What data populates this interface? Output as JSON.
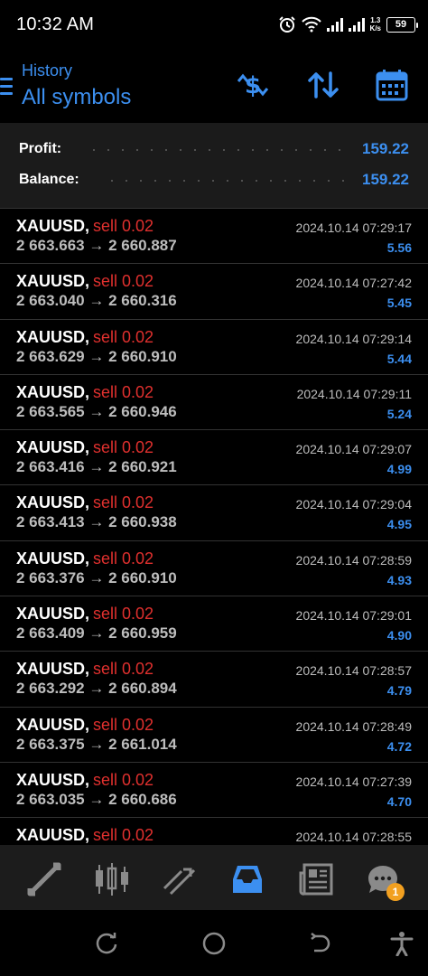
{
  "status_bar": {
    "time": "10:32 AM",
    "net_speed_value": "1.3",
    "net_speed_unit": "K/s",
    "battery": "59",
    "icons": [
      "alarm-icon",
      "wifi-icon",
      "signal-icon",
      "signal-icon-2"
    ]
  },
  "header": {
    "subtitle": "History",
    "title": "All symbols",
    "icons": [
      "menu-icon",
      "currency-sort-icon",
      "sort-icon",
      "calendar-icon"
    ]
  },
  "summary": {
    "profit_label": "Profit:",
    "profit_value": "159.22",
    "balance_label": "Balance:",
    "balance_value": "159.22"
  },
  "deals": [
    {
      "symbol": "XAUUSD,",
      "type": "sell 0.02",
      "prices": "2 663.663 → 2 660.887",
      "time": "2024.10.14 07:29:17",
      "profit": "5.56"
    },
    {
      "symbol": "XAUUSD,",
      "type": "sell 0.02",
      "prices": "2 663.040 → 2 660.316",
      "time": "2024.10.14 07:27:42",
      "profit": "5.45"
    },
    {
      "symbol": "XAUUSD,",
      "type": "sell 0.02",
      "prices": "2 663.629 → 2 660.910",
      "time": "2024.10.14 07:29:14",
      "profit": "5.44"
    },
    {
      "symbol": "XAUUSD,",
      "type": "sell 0.02",
      "prices": "2 663.565 → 2 660.946",
      "time": "2024.10.14 07:29:11",
      "profit": "5.24"
    },
    {
      "symbol": "XAUUSD,",
      "type": "sell 0.02",
      "prices": "2 663.416 → 2 660.921",
      "time": "2024.10.14 07:29:07",
      "profit": "4.99"
    },
    {
      "symbol": "XAUUSD,",
      "type": "sell 0.02",
      "prices": "2 663.413 → 2 660.938",
      "time": "2024.10.14 07:29:04",
      "profit": "4.95"
    },
    {
      "symbol": "XAUUSD,",
      "type": "sell 0.02",
      "prices": "2 663.376 → 2 660.910",
      "time": "2024.10.14 07:28:59",
      "profit": "4.93"
    },
    {
      "symbol": "XAUUSD,",
      "type": "sell 0.02",
      "prices": "2 663.409 → 2 660.959",
      "time": "2024.10.14 07:29:01",
      "profit": "4.90"
    },
    {
      "symbol": "XAUUSD,",
      "type": "sell 0.02",
      "prices": "2 663.292 → 2 660.894",
      "time": "2024.10.14 07:28:57",
      "profit": "4.79"
    },
    {
      "symbol": "XAUUSD,",
      "type": "sell 0.02",
      "prices": "2 663.375 → 2 661.014",
      "time": "2024.10.14 07:28:49",
      "profit": "4.72"
    },
    {
      "symbol": "XAUUSD,",
      "type": "sell 0.02",
      "prices": "2 663.035 → 2 660.686",
      "time": "2024.10.14 07:27:39",
      "profit": "4.70"
    },
    {
      "symbol": "XAUUSD,",
      "type": "sell 0.02",
      "prices": "",
      "time": "2024.10.14 07:28:55",
      "profit": ""
    }
  ],
  "bottom_nav": {
    "items": [
      "quotes-icon",
      "chart-icon",
      "trade-icon",
      "history-icon",
      "news-icon",
      "chat-icon"
    ],
    "active": "history-icon",
    "chat_badge": "1"
  },
  "system_nav": {
    "items": [
      "recent-apps-icon",
      "home-icon",
      "back-icon",
      "accessibility-icon"
    ]
  },
  "colors": {
    "accent": "#3c8ff0",
    "sell": "#e0302e",
    "badge": "#f2a020",
    "background": "#000000",
    "panel": "#1b1b1b"
  }
}
